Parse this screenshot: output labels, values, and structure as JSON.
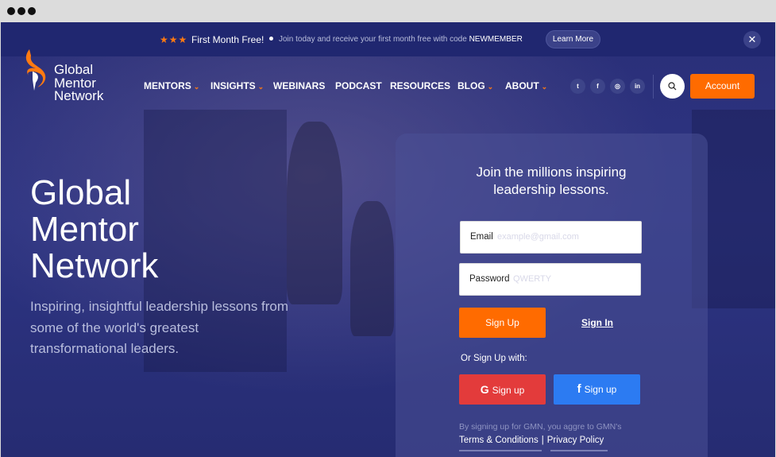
{
  "announcement": {
    "stars": "★★★",
    "headline": "First Month Free!",
    "detail": "Join today and receive your first month free with code",
    "code": "NEWMEMBER",
    "learn_more": "Learn More",
    "close": "✕"
  },
  "brand": {
    "line1": "Global",
    "line2": "Mentor",
    "line3": "Network"
  },
  "nav": {
    "items": [
      {
        "label": "MENTORS",
        "caret": "⌄"
      },
      {
        "label": "INSIGHTS",
        "caret": "⌄"
      },
      {
        "label": "WEBINARS"
      },
      {
        "label": "PODCAST"
      },
      {
        "label": "RESOURCES"
      },
      {
        "label": "BLOG",
        "caret": "⌄"
      },
      {
        "label": "ABOUT",
        "caret": "⌄"
      }
    ],
    "social": [
      "t",
      "f",
      "◎",
      "in"
    ],
    "account": "Account"
  },
  "hero": {
    "title_1": "Global",
    "title_2": "Mentor",
    "title_3": "Network",
    "subtitle": "Inspiring, insightful leadership lessons from some of the world's greatest transformational leaders."
  },
  "signup": {
    "title": "Join the millions inspiring leadership lessons.",
    "email_label": "Email",
    "email_placeholder": "example@gmail.com",
    "password_label": "Password",
    "password_placeholder": "QWERTY",
    "signup_button": "Sign Up",
    "signin_link": "Sign In",
    "or_text": "Or Sign Up with:",
    "google_button": "Sign up",
    "facebook_button": "Sign up",
    "legal_text": "By signing up for GMN, you aggre to GMN's",
    "terms": "Terms & Conditions",
    "separator": "|",
    "privacy": "Privacy Policy"
  },
  "colors": {
    "accent": "#ff6b00",
    "background": "#2a2f78",
    "google": "#e33b3b",
    "facebook": "#2c7bf2"
  }
}
